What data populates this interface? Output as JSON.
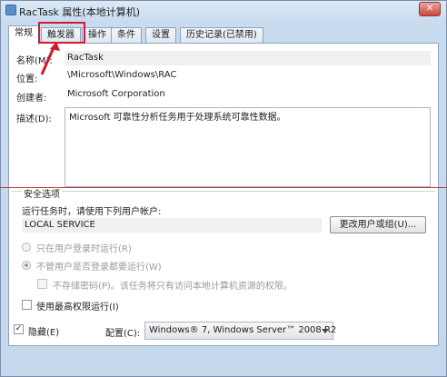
{
  "window": {
    "title": "RacTask 属性(本地计算机)",
    "close_glyph": "✕"
  },
  "tabs": [
    {
      "label": "常规",
      "active": true
    },
    {
      "label": "触发器",
      "active": false
    },
    {
      "label": "操作",
      "active": false
    },
    {
      "label": "条件",
      "active": false
    },
    {
      "label": "设置",
      "active": false
    },
    {
      "label": "历史记录(已禁用)",
      "active": false
    }
  ],
  "general": {
    "name_label": "名称(M):",
    "name_value": "RacTask",
    "location_label": "位置:",
    "location_value": "\\Microsoft\\Windows\\RAC",
    "author_label": "创建者:",
    "author_value": "Microsoft Corporation",
    "description_label": "描述(D):",
    "description_value": "Microsoft 可靠性分析任务用于处理系统可靠性数据。"
  },
  "security": {
    "group_title": "安全选项",
    "run_as_label": "运行任务时，请使用下列用户帐户:",
    "run_as_value": "LOCAL SERVICE",
    "change_user_button": "更改用户或组(U)...",
    "radio_logged_on": "只在用户登录时运行(R)",
    "radio_whether_logged": "不管用户是否登录都要运行(W)",
    "do_not_store_password": "不存储密码(P)。该任务将只有访问本地计算机资源的权限。",
    "highest_privileges": "使用最高权限运行(I)"
  },
  "bottom": {
    "hidden_label": "隐藏(E)",
    "hidden_checked": true,
    "configure_label": "配置(C):",
    "configure_value": "Windows® 7, Windows Server™ 2008 R2"
  },
  "annotation_color": "#d3192c"
}
